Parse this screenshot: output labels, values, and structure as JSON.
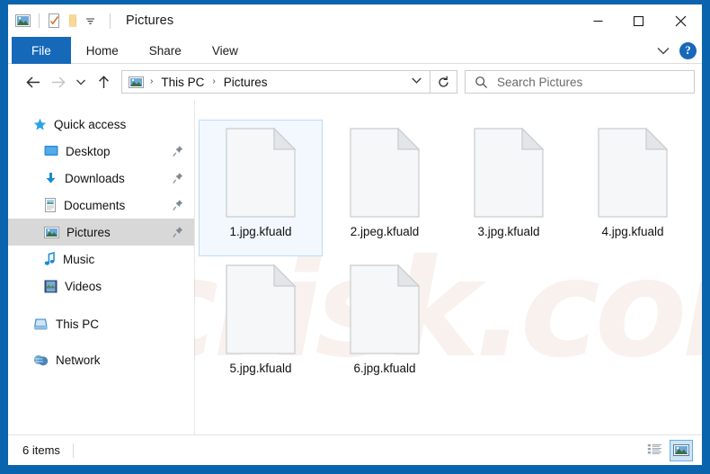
{
  "window": {
    "title": "Pictures",
    "watermark": "pcrisk.com",
    "accent_color": "#0a64ad",
    "selection_color": "#f2f8fd",
    "selection_border": "#bcdcf4"
  },
  "quick_access_toolbar": {
    "items": [
      {
        "name": "pictures-folder-icon",
        "label": "Pictures"
      },
      {
        "name": "properties-icon",
        "label": "Properties"
      },
      {
        "name": "new-folder-icon",
        "label": "New folder"
      },
      {
        "name": "customize-chevron-icon",
        "label": "Customize Quick Access Toolbar"
      }
    ]
  },
  "caption_buttons": [
    {
      "name": "minimize-button",
      "glyph": "—",
      "label": "Minimize"
    },
    {
      "name": "maximize-button",
      "glyph": "□",
      "label": "Maximize"
    },
    {
      "name": "close-button",
      "glyph": "✕",
      "label": "Close"
    }
  ],
  "ribbon": {
    "tabs": [
      {
        "id": "file",
        "label": "File",
        "active": true
      },
      {
        "id": "home",
        "label": "Home",
        "active": false
      },
      {
        "id": "share",
        "label": "Share",
        "active": false
      },
      {
        "id": "view",
        "label": "View",
        "active": false
      }
    ],
    "expand_label": "Expand the Ribbon",
    "help_label": "?"
  },
  "address_bar": {
    "back_label": "Back",
    "forward_label": "Forward",
    "recent_label": "Recent locations",
    "up_label": "Up",
    "breadcrumbs": [
      "This PC",
      "Pictures"
    ],
    "separator": "›",
    "dropdown_label": "Previous locations",
    "refresh_label": "Refresh"
  },
  "search": {
    "placeholder": "Search Pictures",
    "value": "",
    "icon": "search-icon"
  },
  "sidebar": {
    "groups": [
      {
        "header": {
          "label": "Quick access",
          "icon": "star-icon",
          "pinned": false
        },
        "items": [
          {
            "label": "Desktop",
            "icon": "desktop-icon",
            "pinned": true,
            "selected": false
          },
          {
            "label": "Downloads",
            "icon": "downloads-icon",
            "pinned": true,
            "selected": false
          },
          {
            "label": "Documents",
            "icon": "documents-icon",
            "pinned": true,
            "selected": false
          },
          {
            "label": "Pictures",
            "icon": "pictures-icon",
            "pinned": true,
            "selected": true
          },
          {
            "label": "Music",
            "icon": "music-icon",
            "pinned": false,
            "selected": false
          },
          {
            "label": "Videos",
            "icon": "videos-icon",
            "pinned": false,
            "selected": false
          }
        ]
      },
      {
        "header": {
          "label": "This PC",
          "icon": "this-pc-icon",
          "pinned": false
        },
        "items": []
      },
      {
        "header": {
          "label": "Network",
          "icon": "network-icon",
          "pinned": false
        },
        "items": []
      }
    ]
  },
  "files": [
    {
      "name": "1.jpg.kfuald",
      "icon": "blank-document-icon",
      "selected": true
    },
    {
      "name": "2.jpeg.kfuald",
      "icon": "blank-document-icon",
      "selected": false
    },
    {
      "name": "3.jpg.kfuald",
      "icon": "blank-document-icon",
      "selected": false
    },
    {
      "name": "4.jpg.kfuald",
      "icon": "blank-document-icon",
      "selected": false
    },
    {
      "name": "5.jpg.kfuald",
      "icon": "blank-document-icon",
      "selected": false
    },
    {
      "name": "6.jpg.kfuald",
      "icon": "blank-document-icon",
      "selected": false
    }
  ],
  "status_bar": {
    "item_count_text": "6 items",
    "views": [
      {
        "id": "details",
        "label": "Details view",
        "active": false
      },
      {
        "id": "large-icons",
        "label": "Large icons view",
        "active": true
      }
    ]
  }
}
